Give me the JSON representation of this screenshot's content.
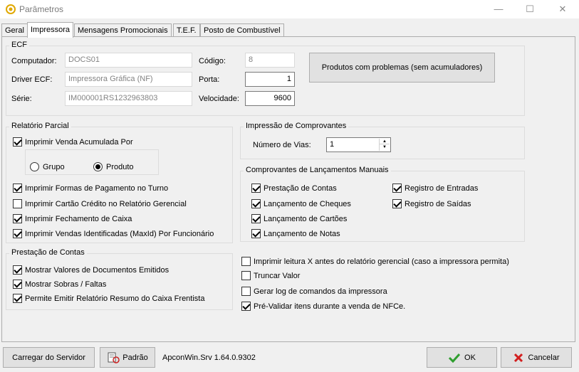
{
  "window": {
    "title": "Parâmetros",
    "minimize": "—",
    "maximize": "☐",
    "close": "✕"
  },
  "tabs": [
    "Geral",
    "Impressora",
    "Mensagens Promocionais",
    "T.E.F.",
    "Posto de Combustível"
  ],
  "ecf": {
    "legend": "ECF",
    "computador_label": "Computador:",
    "computador_value": "DOCS01",
    "driver_label": "Driver ECF:",
    "driver_value": "Impressora Gráfica (NF)",
    "serie_label": "Série:",
    "serie_value": "IM000001RS1232963803",
    "codigo_label": "Código:",
    "codigo_value": "8",
    "porta_label": "Porta:",
    "porta_value": "1",
    "velocidade_label": "Velocidade:",
    "velocidade_value": "9600",
    "produtos_button": "Produtos com problemas (sem acumuladores)"
  },
  "relatorio": {
    "legend": "Relatório Parcial",
    "venda_acumulada": "Imprimir Venda Acumulada Por",
    "grupo": "Grupo",
    "produto": "Produto",
    "formas_pagamento": "Imprimir Formas de Pagamento no Turno",
    "cartao_credito": "Imprimir Cartão Crédito no Relatório Gerencial",
    "fechamento_caixa": "Imprimir Fechamento de Caixa",
    "vendas_identificadas": "Imprimir Vendas Identificadas (MaxId) Por Funcionário"
  },
  "prestacao": {
    "legend": "Prestação de Contas",
    "mostrar_valores": "Mostrar Valores de Documentos Emitidos",
    "mostrar_sobras": "Mostrar Sobras / Faltas",
    "permite_emitir": "Permite Emitir Relatório Resumo do Caixa Frentista"
  },
  "comprovantes": {
    "legend": "Impressão de Comprovantes",
    "vias_label": "Número de Vias:",
    "vias_value": "1"
  },
  "lancamentos": {
    "legend": "Comprovantes de Lançamentos Manuais",
    "prestacao_contas": "Prestação de Contas",
    "lanc_cheques": "Lançamento de Cheques",
    "lanc_cartoes": "Lançamento de Cartões",
    "lanc_notas": "Lançamento de Notas",
    "reg_entradas": "Registro de Entradas",
    "reg_saidas": "Registro de Saídas"
  },
  "options": {
    "leitura_x": "Imprimir leitura X antes do relatório gerencial (caso a impressora permita)",
    "truncar": "Truncar Valor",
    "gerar_log": "Gerar log de comandos da impressora",
    "pre_validar": "Pré-Validar itens durante a venda de NFCe."
  },
  "footer": {
    "carregar": "Carregar do Servidor",
    "padrao": "Padrão",
    "version": "ApconWin.Srv 1.64.0.9302",
    "ok": "OK",
    "cancelar": "Cancelar"
  },
  "colors": {
    "ok_check": "#2e9e2e",
    "cancel_x": "#d21f1f",
    "title_icon": "#f0b400"
  }
}
